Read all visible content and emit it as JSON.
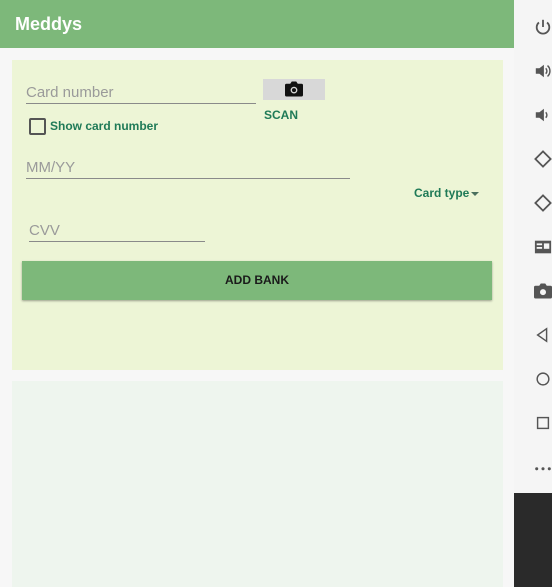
{
  "app": {
    "title": "Meddys"
  },
  "form": {
    "card_number_placeholder": "Card number",
    "scan_label": "SCAN",
    "show_card_number_label": "Show card number",
    "expiry_placeholder": "MM/YY",
    "card_type_label": "Card type",
    "cvv_placeholder": "CVV",
    "add_bank_label": "ADD BANK"
  },
  "sidebar": {
    "icons": [
      "power-icon",
      "volume-up-icon",
      "volume-down-icon",
      "rotate-left-icon",
      "rotate-right-icon",
      "media-icon",
      "camera-icon",
      "back-icon",
      "home-icon",
      "recents-icon",
      "more-icon"
    ]
  },
  "colors": {
    "appbar": "#7db87a",
    "card_bg": "#edf5d6",
    "accent_text": "#1f7a57",
    "button": "#7db87a"
  }
}
